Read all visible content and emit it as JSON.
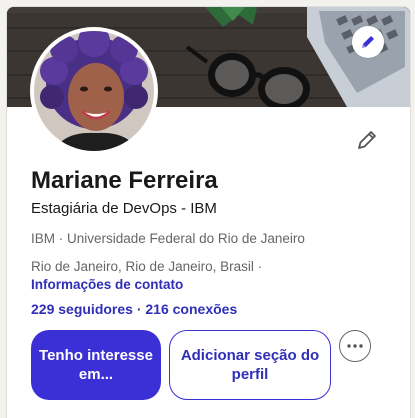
{
  "profile": {
    "name": "Mariane Ferreira",
    "headline": "Estagiária de DevOps - IBM",
    "company": "IBM",
    "separator": " · ",
    "university": "Universidade Federal do Rio de Janeiro",
    "location": "Rio de Janeiro, Rio de Janeiro, Brasil ·",
    "contact_link": "Informações de contato",
    "followers": "229 seguidores",
    "connections": "216 conexões"
  },
  "actions": {
    "primary_label": "Tenho interesse em...",
    "secondary_label": "Adicionar seção do perfil"
  },
  "icons": {
    "cover_edit": "pencil-icon",
    "profile_edit": "pencil-icon",
    "more": "ellipsis-icon"
  },
  "colors": {
    "brand": "#3b2fd6",
    "link": "#2f2fb8",
    "muted_text": "#666666",
    "primary_text": "#191919"
  }
}
